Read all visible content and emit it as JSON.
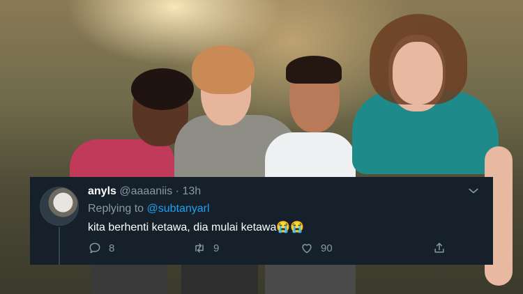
{
  "tweet": {
    "display_name": "anyls",
    "handle": "@aaaaniis",
    "separator": "·",
    "time": "13h",
    "replying_prefix": "Replying to",
    "replying_to": "@subtanyarl",
    "text": "kita berhenti ketawa, dia mulai ketawa😭😭",
    "replies": "8",
    "retweets": "9",
    "likes": "90"
  },
  "icons": {
    "reply": "reply-icon",
    "retweet": "retweet-icon",
    "like": "heart-icon",
    "share": "share-icon",
    "menu": "chevron-down-icon"
  },
  "colors": {
    "tweet_background": "#15202b",
    "secondary_text": "#8899a6",
    "link": "#1da1f2",
    "primary_text": "#ffffff"
  }
}
